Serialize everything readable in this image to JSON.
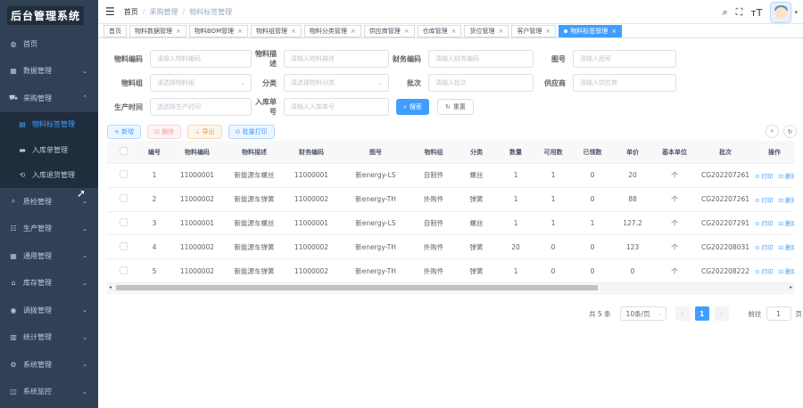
{
  "app": {
    "logo_text": "后台管理系统"
  },
  "sidebar": {
    "items": [
      {
        "label": "首页",
        "icon": "dashboard-icon",
        "glyph": "◍"
      },
      {
        "label": "数据管理",
        "icon": "table-icon",
        "glyph": "▦",
        "chevron": "⌄"
      },
      {
        "label": "采购管理",
        "icon": "cart-icon",
        "glyph": "⛟",
        "chevron": "⌃"
      }
    ],
    "sub_items": [
      {
        "label": "物料标签管理",
        "icon": "label-icon",
        "glyph": "▤",
        "active": true
      },
      {
        "label": "入库单管理",
        "icon": "document-icon",
        "glyph": "▬"
      },
      {
        "label": "入库退货管理",
        "icon": "return-icon",
        "glyph": "⟲"
      }
    ],
    "items_after": [
      {
        "label": "质检管理",
        "icon": "search-icon",
        "glyph": "⌕",
        "chevron": "⌄"
      },
      {
        "label": "生产管理",
        "icon": "production-icon",
        "glyph": "☷",
        "chevron": "⌄"
      },
      {
        "label": "通用管理",
        "icon": "grid-icon",
        "glyph": "▦",
        "chevron": "⌄"
      },
      {
        "label": "库存管理",
        "icon": "warehouse-icon",
        "glyph": "⌂",
        "chevron": "⌄"
      },
      {
        "label": "调拨管理",
        "icon": "transfer-icon",
        "glyph": "◉",
        "chevron": "⌄"
      },
      {
        "label": "统计管理",
        "icon": "chart-icon",
        "glyph": "▥",
        "chevron": "⌄"
      },
      {
        "label": "系统管理",
        "icon": "gear-icon",
        "glyph": "⚙",
        "chevron": "⌄"
      },
      {
        "label": "系统监控",
        "icon": "monitor-icon",
        "glyph": "◫",
        "chevron": "⌄"
      }
    ]
  },
  "header": {
    "hamburger": "☰",
    "breadcrumb": [
      "首页",
      "采购管理",
      "物料标签管理"
    ],
    "icons": {
      "search": "⌕",
      "fullscreen": "⛶",
      "font_size": "тT",
      "avatar_caret": "▾"
    }
  },
  "tags": [
    {
      "label": "首页",
      "closable": false,
      "active": false
    },
    {
      "label": "物料数据管理",
      "closable": true,
      "active": false
    },
    {
      "label": "物料BOM管理",
      "closable": true,
      "active": false
    },
    {
      "label": "物料组管理",
      "closable": true,
      "active": false
    },
    {
      "label": "物料分类管理",
      "closable": true,
      "active": false
    },
    {
      "label": "供应商管理",
      "closable": true,
      "active": false
    },
    {
      "label": "仓库管理",
      "closable": true,
      "active": false
    },
    {
      "label": "货位管理",
      "closable": true,
      "active": false
    },
    {
      "label": "客户管理",
      "closable": true,
      "active": false
    },
    {
      "label": "物料标签管理",
      "closable": true,
      "active": true
    }
  ],
  "form": {
    "fields": [
      {
        "label": "物料编码",
        "placeholder": "请输入物料编码"
      },
      {
        "label": "物料描述",
        "placeholder": "请输入物料描述"
      },
      {
        "label": "财务编码",
        "placeholder": "请输入财务编码"
      },
      {
        "label": "图号",
        "placeholder": "请输入图号"
      },
      {
        "label": "物料组",
        "placeholder": "请选择物料组",
        "select": true
      },
      {
        "label": "分类",
        "placeholder": "请选择物料分类",
        "select": true
      },
      {
        "label": "批次",
        "placeholder": "请输入批次"
      },
      {
        "label": "供应商",
        "placeholder": "请输入供应商"
      },
      {
        "label": "生产时间",
        "placeholder": "选选择生产时间"
      },
      {
        "label": "入库单号",
        "placeholder": "请输入入库单号"
      }
    ],
    "search_label": "搜索",
    "reset_label": "重置",
    "select_arrow": "⌄"
  },
  "toolbar": {
    "add": "+ 新增",
    "delete": "⊡ 删除",
    "export": "⊥ 导出",
    "batch_print": "⊙ 批量打印",
    "search_toggle": "⌕",
    "refresh": "↻"
  },
  "table": {
    "columns": [
      "",
      "编号",
      "物料编码",
      "物料描述",
      "财务编码",
      "图号",
      "物料组",
      "分类",
      "数量",
      "可用数",
      "已领数",
      "单价",
      "基本单位",
      "批次",
      "操作"
    ],
    "rows": [
      [
        "1",
        "11000001",
        "新能源车螺丝",
        "11000001",
        "新energy-LS",
        "自制件",
        "螺丝",
        "1",
        "1",
        "0",
        "20",
        "个",
        "CG202207261"
      ],
      [
        "2",
        "11000002",
        "新能源车弹簧",
        "11000002",
        "新energy-TH",
        "外购件",
        "弹簧",
        "1",
        "1",
        "0",
        "88",
        "个",
        "CG202207261"
      ],
      [
        "3",
        "11000001",
        "新能源车螺丝",
        "11000001",
        "新energy-LS",
        "自制件",
        "螺丝",
        "1",
        "1",
        "1",
        "127.2",
        "个",
        "CG202207291"
      ],
      [
        "4",
        "11000002",
        "新能源车弹簧",
        "11000002",
        "新energy-TH",
        "外购件",
        "弹簧",
        "20",
        "0",
        "0",
        "123",
        "个",
        "CG202208031"
      ],
      [
        "5",
        "11000002",
        "新能源车弹簧",
        "11000002",
        "新energy-TH",
        "外购件",
        "弹簧",
        "1",
        "0",
        "0",
        "0",
        "个",
        "CG202208222"
      ]
    ],
    "print_label": "⊙ 打印",
    "delete_label": "⊡ 删除"
  },
  "pagination": {
    "total": "共 5 条",
    "page_size": "10条/页",
    "prev": "‹",
    "next": "›",
    "current": "1",
    "goto_label": "前往",
    "goto_value": "1",
    "page_suffix": "页"
  },
  "scrollbar": {
    "left_arrow": "◂",
    "right_arrow": "▸"
  },
  "colors": {
    "sidebar_bg": "#304156",
    "primary": "#409eff",
    "active_sub": "#409eff"
  }
}
